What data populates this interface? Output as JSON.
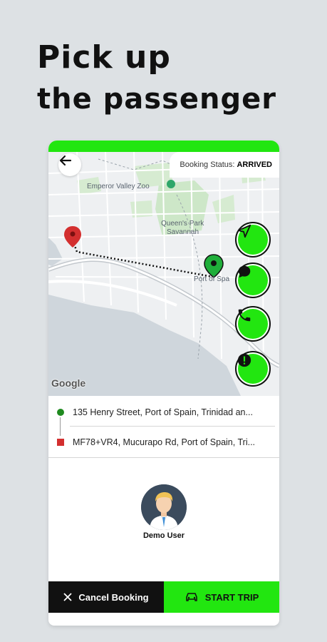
{
  "headline": {
    "line1": "Pick up",
    "line2": "the passenger"
  },
  "map": {
    "labels": {
      "zoo": "Emperor Valley Zoo",
      "savannah_1": "Queen's Park",
      "savannah_2": "Savannah",
      "port": "Port of Spa",
      "attribution": "Google"
    }
  },
  "booking_status": {
    "label": "Booking Status:",
    "value": "ARRIVED"
  },
  "route": {
    "pickup": "135 Henry Street, Port of Spain, Trinidad an...",
    "dropoff": "MF78+VR4, Mucurapo Rd, Port of Spain, Tri..."
  },
  "passenger": {
    "name": "Demo User"
  },
  "actions": {
    "cancel": "Cancel Booking",
    "start": "START TRIP"
  },
  "icons": {
    "back": "arrow-left-icon",
    "navigate": "navigation-arrow-icon",
    "chat": "chat-bubble-icon",
    "call": "phone-icon",
    "sos": "alert-icon",
    "cancel": "close-icon",
    "start": "car-icon"
  },
  "colors": {
    "accent": "#22e610",
    "dark": "#111111",
    "pickup_marker": "#1f8a1f",
    "dropoff_marker": "#d32f2f"
  }
}
